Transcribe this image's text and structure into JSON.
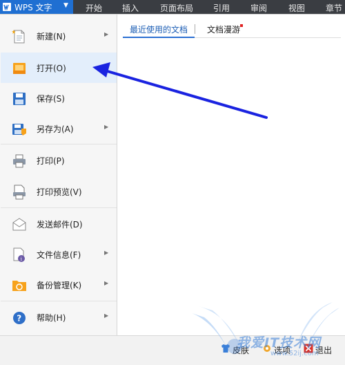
{
  "app": {
    "title": "WPS 文字",
    "menu_arrow": "▼"
  },
  "ribbon_tabs": [
    "开始",
    "插入",
    "页面布局",
    "引用",
    "审阅",
    "视图",
    "章节"
  ],
  "file_menu": {
    "items": [
      {
        "label": "新建(N)",
        "icon": "new-document-icon",
        "has_submenu": true
      },
      {
        "label": "打开(O)",
        "icon": "open-folder-icon",
        "has_submenu": false,
        "selected": true
      },
      {
        "label": "保存(S)",
        "icon": "save-disk-icon",
        "has_submenu": false
      },
      {
        "label": "另存为(A)",
        "icon": "save-as-icon",
        "has_submenu": true
      },
      {
        "label": "打印(P)",
        "icon": "printer-icon",
        "has_submenu": false
      },
      {
        "label": "打印预览(V)",
        "icon": "print-preview-icon",
        "has_submenu": false
      },
      {
        "label": "发送邮件(D)",
        "icon": "mail-envelope-icon",
        "has_submenu": false
      },
      {
        "label": "文件信息(F)",
        "icon": "file-info-icon",
        "has_submenu": true
      },
      {
        "label": "备份管理(K)",
        "icon": "backup-folder-icon",
        "has_submenu": true
      },
      {
        "label": "帮助(H)",
        "icon": "help-icon",
        "has_submenu": true
      }
    ]
  },
  "documents_panel": {
    "tabs": [
      {
        "label": "最近使用的文档",
        "active": true
      },
      {
        "label": "文档漫游",
        "active": false,
        "badge_color": "#e02020"
      }
    ]
  },
  "bottom_bar": {
    "skin_label": "皮肤",
    "options_label": "选项",
    "exit_label": "退出"
  },
  "watermark": {
    "text": "我爱IT技术网",
    "url": "www.52ij.com"
  },
  "colors": {
    "accent": "#1f6fd2",
    "selected_bg": "#e3eefb",
    "annotation_arrow": "#1a23e0"
  }
}
